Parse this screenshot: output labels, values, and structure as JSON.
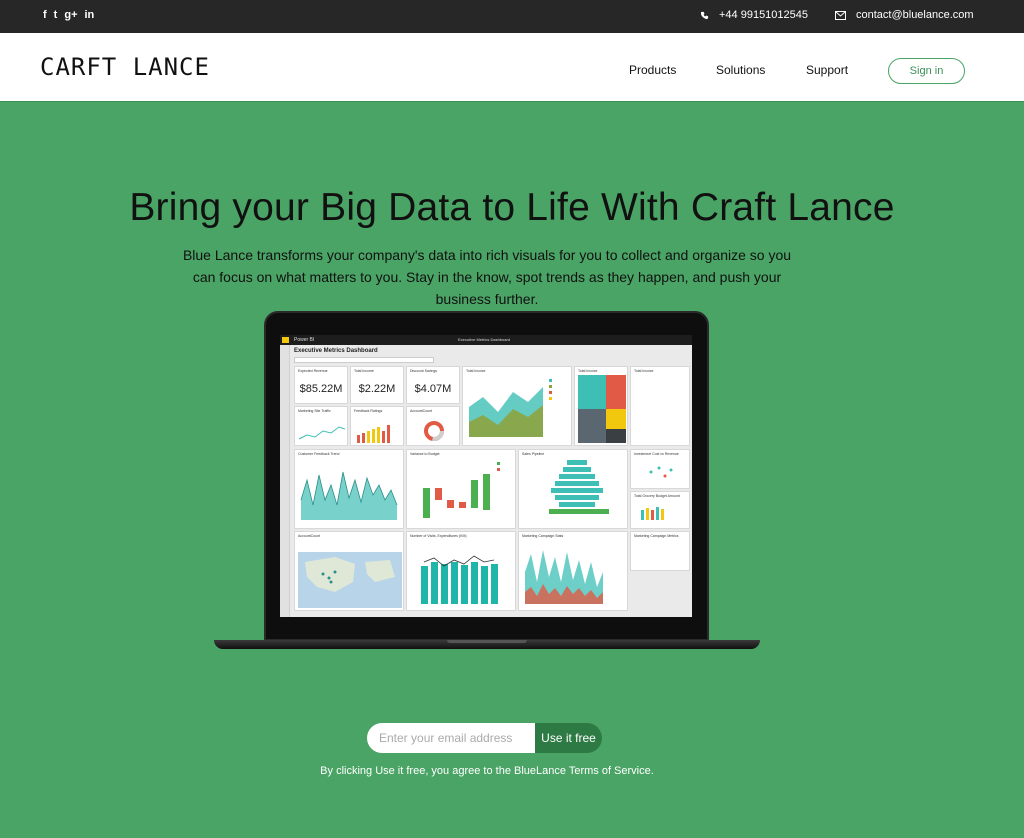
{
  "topbar": {
    "social": [
      {
        "icon": "facebook-icon",
        "glyph": "f"
      },
      {
        "icon": "twitter-icon",
        "glyph": "t"
      },
      {
        "icon": "google-plus-icon",
        "glyph": "g+"
      },
      {
        "icon": "linkedin-icon",
        "glyph": "in"
      }
    ],
    "phone": "+44 99151012545",
    "email": "contact@bluelance.com"
  },
  "navbar": {
    "logo": "CARFT LANCE",
    "links": [
      "Products",
      "Solutions",
      "Support"
    ],
    "signin": "Sign in"
  },
  "hero": {
    "title": "Bring your Big Data to Life With Craft Lance",
    "subtitle": "Blue Lance transforms your company's data into rich visuals for you to collect and organize so you can focus on what matters to you. Stay in the know, spot trends as they happen, and push your business further."
  },
  "dashboard": {
    "app_name": "Power BI",
    "dashboard_name": "Executive Metrics Dashboard",
    "title": "Executive Metrics Dashboard",
    "kpis": [
      {
        "label": "Expected Revenue",
        "value": "$85.22M"
      },
      {
        "label": "Total Income",
        "value": "$2.22M"
      },
      {
        "label": "Discount Savings",
        "value": "$4.07M"
      }
    ],
    "tiles": [
      "Total Invoice",
      "Total Invoice",
      "Marketing Site Traffic",
      "Feedback Ratings",
      "AccountCount",
      "Customer Feedback Trend",
      "Variance to Budget",
      "Sales Pipeline",
      "Investment Cost vs Revenue",
      "Total Grocery Budget Amount",
      "AccountCount",
      "Number of Visits, Expenditures (KM)",
      "Marketing Campaign Stats",
      "Marketing Campaign Metrics"
    ],
    "colors": {
      "teal": "#3ebfb5",
      "yellow": "#f2c80f",
      "red": "#e15a46",
      "green": "#4caf50",
      "gray": "#5a6770"
    }
  },
  "signup": {
    "placeholder": "Enter your email address",
    "button": "Use it free",
    "terms": "By clicking Use it free, you agree to the BlueLance Terms of Service."
  }
}
